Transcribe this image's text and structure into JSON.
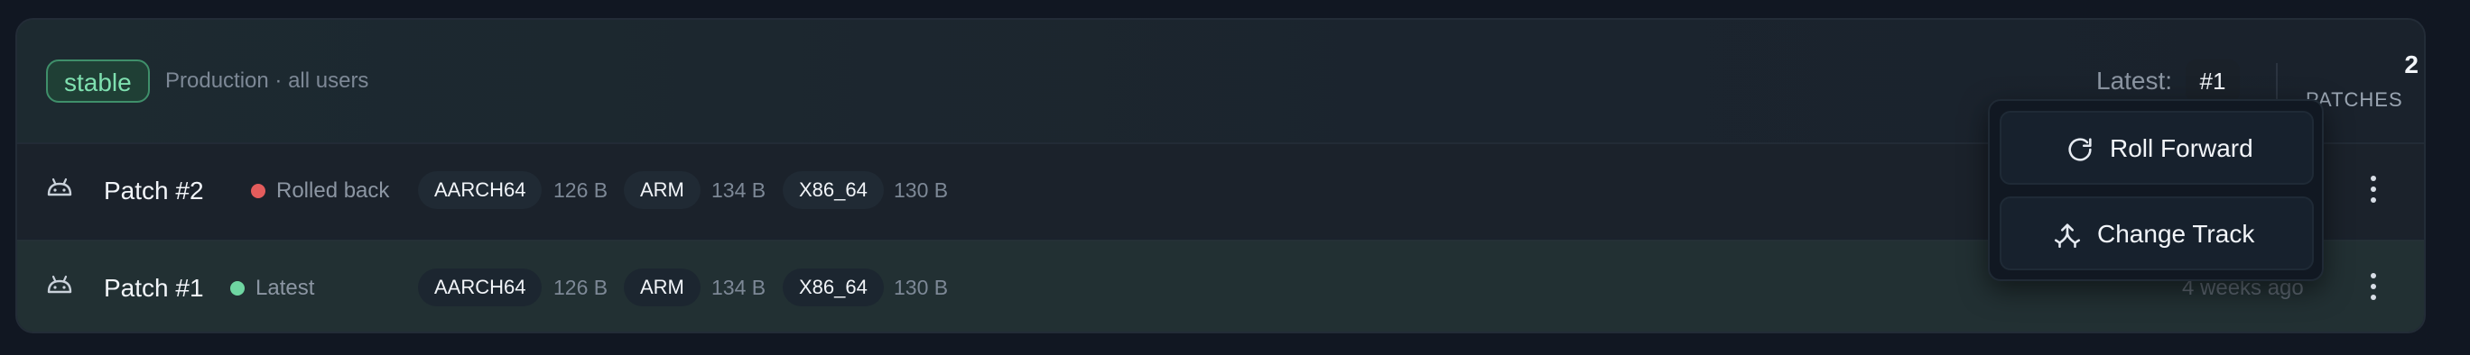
{
  "track": {
    "badge": "stable",
    "description": "Production · all users",
    "latest_label": "Latest:",
    "latest_value": "#1",
    "patch_count": "2",
    "patch_count_label": "PATCHES"
  },
  "patches": [
    {
      "name": "Patch #2",
      "status": "Rolled back",
      "status_color": "#e35c5c",
      "archs": [
        {
          "name": "AARCH64",
          "size": "126 B"
        },
        {
          "name": "ARM",
          "size": "134 B"
        },
        {
          "name": "X86_64",
          "size": "130 B"
        }
      ],
      "time": ""
    },
    {
      "name": "Patch #1",
      "status": "Latest",
      "status_color": "#6fd6a2",
      "archs": [
        {
          "name": "AARCH64",
          "size": "126 B"
        },
        {
          "name": "ARM",
          "size": "134 B"
        },
        {
          "name": "X86_64",
          "size": "130 B"
        }
      ],
      "time": "4 weeks ago"
    }
  ],
  "menu": {
    "roll_forward": "Roll Forward",
    "change_track": "Change Track"
  },
  "icons": {
    "platform": "android-icon",
    "row_menu": "more-vertical-icon",
    "roll_forward": "rotate-cw-icon",
    "change_track": "split-arrows-icon"
  },
  "colors": {
    "accent_green": "#6fd6a2",
    "danger_red": "#e35c5c",
    "background": "#111722"
  }
}
